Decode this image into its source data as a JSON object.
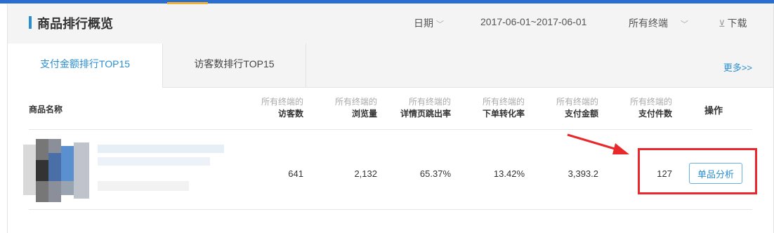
{
  "header": {
    "title": "商品排行概览",
    "date_label": "日期",
    "date_range": "2017-06-01~2017-06-01",
    "terminal": "所有终端",
    "download": "下载",
    "chevron_icon": "chevron-down-icon",
    "download_icon": "download-icon"
  },
  "tabs": [
    {
      "label": "支付金额排行TOP15"
    },
    {
      "label": "访客数排行TOP15"
    }
  ],
  "more_link": "更多>>",
  "columns": {
    "name": "商品名称",
    "prefix": "所有终端的",
    "visitors": "访客数",
    "pageviews": "浏览量",
    "bounce": "详情页跳出率",
    "order_conv": "下单转化率",
    "pay_amount": "支付金额",
    "pay_items": "支付件数",
    "action": "操作"
  },
  "row": {
    "visitors": "641",
    "pageviews": "2,132",
    "bounce": "65.37%",
    "order_conv": "13.42%",
    "pay_amount": "3,393.2",
    "pay_items": "127",
    "action_button": "单品分析"
  },
  "colors": {
    "accent": "#2a8fd0",
    "highlight": "#e8282b"
  }
}
